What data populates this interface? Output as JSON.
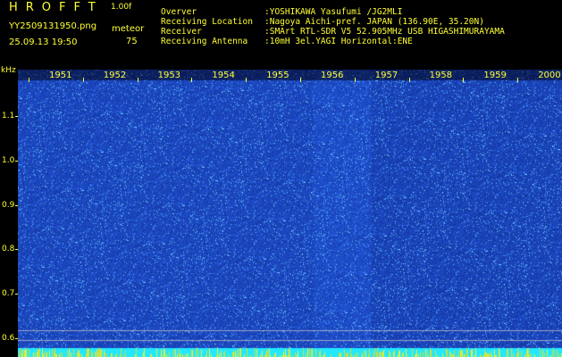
{
  "header": {
    "app_title": "HROFFT",
    "version": "1.00f",
    "filename": "YY2509131950.png",
    "mode_label": "meteor",
    "datetime": "25.09.13 19:50",
    "meteor_count": "75"
  },
  "info": [
    {
      "key": "Overver",
      "value": ":YOSHIKAWA Yasufumi /JG2MLI"
    },
    {
      "key": "Receiving Location",
      "value": ":Nagoya Aichi-pref. JAPAN (136.90E, 35.20N)"
    },
    {
      "key": "Receiver",
      "value": ":SMArt RTL-SDR V5 52.905MHz USB HIGASHIMURAYAMA"
    },
    {
      "key": "Receiving Antenna",
      "value": ":10mH 3el.YAGI Horizontal:ENE"
    }
  ],
  "freq_axis": {
    "unit": "kHz",
    "ticks": [
      {
        "value": 1.1,
        "label": "1.1"
      },
      {
        "value": 1.0,
        "label": "1.0"
      },
      {
        "value": 0.9,
        "label": "0.9"
      },
      {
        "value": 0.8,
        "label": "0.8"
      },
      {
        "value": 0.7,
        "label": "0.7"
      },
      {
        "value": 0.6,
        "label": "0.6"
      }
    ]
  },
  "time_axis": {
    "ticks": [
      "1951",
      "1952",
      "1953",
      "1954",
      "1955",
      "1956",
      "1957",
      "1958",
      "1959",
      "2000"
    ]
  },
  "colors": {
    "text": "#ffff33",
    "background": "#000000",
    "spectrum_base": "#1a2fa6",
    "spectrum_bright": "#7fd0ff",
    "bottom_band": "#22e8ff",
    "marker_lines": "#9aa4c8"
  }
}
